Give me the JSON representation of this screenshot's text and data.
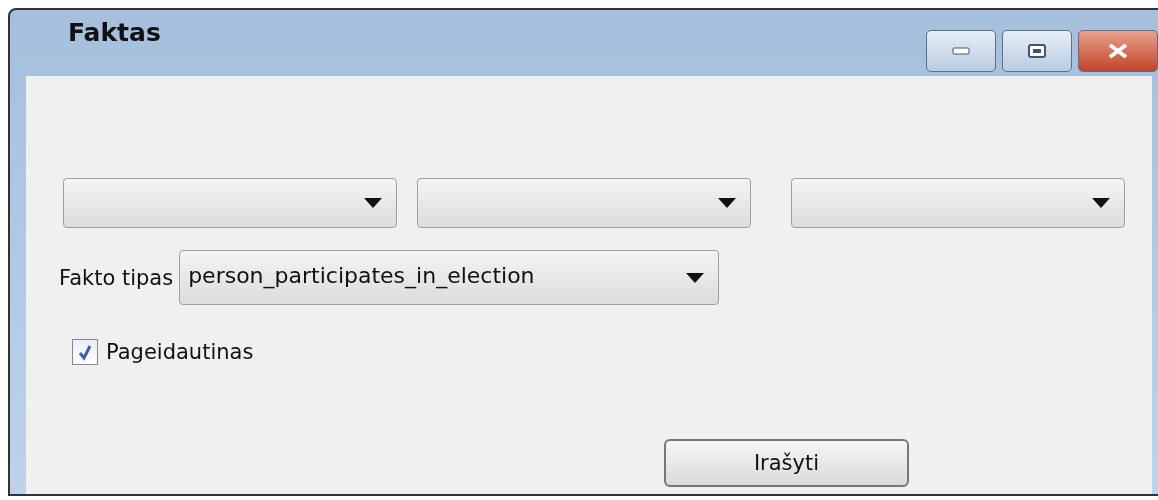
{
  "window": {
    "title": "Faktas"
  },
  "dropdowns": [
    {
      "kind": "empty"
    },
    {
      "kind": "empty"
    },
    {
      "kind": "empty"
    }
  ],
  "fact_type": {
    "label": "Fakto tipas",
    "value": "person_participates_in_election"
  },
  "preferred": {
    "label": "Pageidautinas",
    "checked": true
  },
  "buttons": [
    {
      "label": "Irašyti"
    }
  ]
}
